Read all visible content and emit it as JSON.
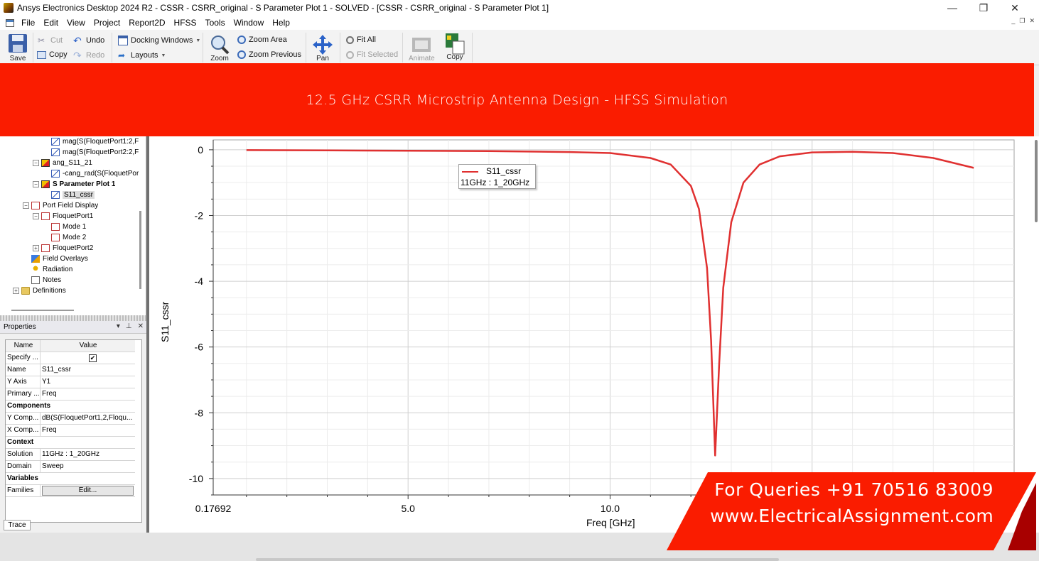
{
  "window": {
    "title": "Ansys Electronics Desktop 2024 R2 - CSSR - CSRR_original - S Parameter Plot 1 - SOLVED - [CSSR - CSRR_original - S Parameter Plot 1]",
    "minimize": "—",
    "maximize": "❐",
    "close": "✕"
  },
  "menu": [
    "File",
    "Edit",
    "View",
    "Project",
    "Report2D",
    "HFSS",
    "Tools",
    "Window",
    "Help"
  ],
  "toolbar": {
    "save": "Save",
    "cut": "Cut",
    "copy": "Copy",
    "undo": "Undo",
    "redo": "Redo",
    "docking_windows": "Docking Windows",
    "layouts": "Layouts",
    "zoom": "Zoom",
    "zoom_area": "Zoom Area",
    "zoom_previous": "Zoom Previous",
    "pan": "Pan",
    "fit_all": "Fit All",
    "fit_selected": "Fit Selected",
    "animate": "Animate",
    "copy_image": "Copy"
  },
  "banner": {
    "text": "12.5 GHz CSRR Microstrip Antenna Design - HFSS Simulation"
  },
  "tree": [
    {
      "label": "mag(S(FloquetPort1:2,F",
      "indent": 2,
      "icon": "trace",
      "expander": ""
    },
    {
      "label": "mag(S(FloquetPort2:2,F",
      "indent": 2,
      "icon": "trace",
      "expander": ""
    },
    {
      "label": "ang_S11_21",
      "indent": 1,
      "icon": "plot",
      "expander": "−"
    },
    {
      "label": "-cang_rad(S(FloquetPor",
      "indent": 2,
      "icon": "trace",
      "expander": ""
    },
    {
      "label": "S Parameter Plot 1",
      "indent": 1,
      "icon": "plot",
      "expander": "−",
      "bold": true
    },
    {
      "label": "S11_cssr",
      "indent": 2,
      "icon": "trace",
      "expander": "",
      "selected": true
    },
    {
      "label": "Port Field Display",
      "indent": 0,
      "icon": "mode",
      "expander": "−"
    },
    {
      "label": "FloquetPort1",
      "indent": 1,
      "icon": "mode",
      "expander": "−"
    },
    {
      "label": "Mode 1",
      "indent": 2,
      "icon": "mode",
      "expander": ""
    },
    {
      "label": "Mode 2",
      "indent": 2,
      "icon": "mode",
      "expander": ""
    },
    {
      "label": "FloquetPort2",
      "indent": 1,
      "icon": "mode",
      "expander": "+"
    },
    {
      "label": "Field Overlays",
      "indent": 0,
      "icon": "overlay",
      "expander": ""
    },
    {
      "label": "Radiation",
      "indent": 0,
      "icon": "radiation",
      "expander": ""
    },
    {
      "label": "Notes",
      "indent": 0,
      "icon": "note",
      "expander": ""
    },
    {
      "label": "Definitions",
      "indent": -1,
      "icon": "folder",
      "expander": "+"
    }
  ],
  "properties": {
    "title": "Properties",
    "col_name": "Name",
    "col_value": "Value",
    "specify_name": "Specify ...",
    "name_label": "Name",
    "name_value": "S11_cssr",
    "yaxis_label": "Y Axis",
    "yaxis_value": "Y1",
    "primary_label": "Primary ...",
    "primary_value": "Freq",
    "components": "Components",
    "ycomp_label": "Y Comp...",
    "ycomp_value": "dB(S(FloquetPort1,2,Floqu...",
    "xcomp_label": "X Comp...",
    "xcomp_value": "Freq",
    "context": "Context",
    "solution_label": "Solution",
    "solution_value": "11GHz : 1_20GHz",
    "domain_label": "Domain",
    "domain_value": "Sweep",
    "variables": "Variables",
    "families_label": "Families",
    "families_button": "Edit...",
    "tab": "Trace"
  },
  "chart_data": {
    "type": "line",
    "xlabel": "Freq [GHz]",
    "ylabel": "S11_cssr",
    "xlim": [
      0.17692,
      20
    ],
    "ylim": [
      -10.5,
      0.3
    ],
    "x_ticks": [
      "0.17692",
      "5.0",
      "10.0"
    ],
    "y_ticks": [
      0,
      -2,
      -4,
      -6,
      -8,
      -10
    ],
    "grid": true,
    "legend": {
      "position": "top-center",
      "series": "S11_cssr",
      "solution": "11GHz : 1_20GHz"
    },
    "series": [
      {
        "name": "S11_cssr",
        "color": "#e03030",
        "x": [
          1.0,
          3.0,
          5.0,
          7.0,
          9.0,
          10.0,
          11.0,
          11.5,
          12.0,
          12.2,
          12.4,
          12.5,
          12.55,
          12.6,
          12.7,
          12.8,
          13.0,
          13.3,
          13.7,
          14.2,
          15.0,
          16.0,
          17.0,
          18.0,
          19.0
        ],
        "y": [
          -0.01,
          -0.02,
          -0.03,
          -0.04,
          -0.07,
          -0.1,
          -0.25,
          -0.45,
          -1.1,
          -1.8,
          -3.6,
          -5.8,
          -7.5,
          -9.3,
          -6.5,
          -4.2,
          -2.2,
          -1.0,
          -0.45,
          -0.2,
          -0.08,
          -0.06,
          -0.1,
          -0.25,
          -0.55
        ]
      }
    ]
  },
  "contact": {
    "line1": "For Queries +91 70516 83009",
    "line2": "www.ElectricalAssignment.com"
  },
  "colors": {
    "banner": "#fa1c00",
    "trace": "#e03030"
  }
}
